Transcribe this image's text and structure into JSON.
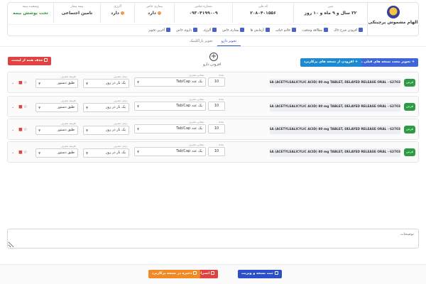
{
  "header": {
    "brand": "الهام مشموش پرچینکی",
    "info": [
      {
        "label": "سن",
        "value": "۳۲ سال و ۹ ماه و ۱۰ روز",
        "width": 104
      },
      {
        "label": "کد ملی",
        "value": "۲۰۸۰۴۰۱۵۵۶",
        "width": 86
      },
      {
        "label": "شماره تماس",
        "value": "۰۹۳۰۴۱۹۹۰۰۹",
        "width": 82
      },
      {
        "label": "بیماری خاص",
        "value": "دارد",
        "width": 56
      },
      {
        "label": "آلرژی",
        "value": "دارد",
        "width": 48
      },
      {
        "label": "بیمه بیمار",
        "value": "تامین اجتماعی",
        "width": 66
      },
      {
        "label": "وضعیت بیمه",
        "value": "تحت پوشش بیمه",
        "width": 64
      }
    ],
    "quick_links": [
      {
        "label": "افزودن شرح حال",
        "icon": "add-history-icon"
      },
      {
        "label": "مطالعه وضعیت",
        "icon": "status-icon"
      },
      {
        "label": "علایم حیاتی",
        "icon": "vital-signs-icon"
      },
      {
        "label": "آزمایش ها",
        "icon": "lab-tests-icon"
      },
      {
        "label": "بیماری خاص",
        "icon": "special-disease-icon"
      },
      {
        "label": "آلرژی",
        "icon": "allergy-icon"
      },
      {
        "label": "داروی خاص",
        "icon": "special-drug-icon"
      },
      {
        "label": "آخرین تجویز",
        "icon": "last-prescription-icon"
      }
    ]
  },
  "tabs": {
    "drug": "تجویز دارو",
    "paraclinic": "تجویز پاراکلینیک"
  },
  "add_drug": {
    "label": "افزودن دارو"
  },
  "actions": {
    "renew": "+ تجویز مجدد نسخه های قبلی بیمار",
    "frequent": "+ افزودن از نسخه های پرکاربرد",
    "delete_all": "حذف همه از لیست"
  },
  "field_labels": {
    "count": "تعداد",
    "unit": "مقادیر مصرف",
    "freq": "زمان مصرف",
    "method": "طریقه مصرف"
  },
  "drugs": [
    {
      "badge": "قرص",
      "name": "ASA (ACETYLSALICYLIC ACID) 80 mg TABLET, DELAYED RELEASE ORAL - 62703",
      "count": "10",
      "unit": "یک عدد Tab/Cap",
      "freq": "یک بار در روز",
      "method": "طبق دستور"
    },
    {
      "badge": "قرص",
      "name": "ASA (ACETYLSALICYLIC ACID) 80 mg TABLET, DELAYED RELEASE ORAL - 62703",
      "count": "10",
      "unit": "یک عدد Tab/Cap",
      "freq": "یک بار در روز",
      "method": "طبق دستور"
    },
    {
      "badge": "قرص",
      "name": "ASA (ACETYLSALICYLIC ACID) 80 mg TABLET, DELAYED RELEASE ORAL - 62703",
      "count": "10",
      "unit": "یک عدد Tab/Cap",
      "freq": "یک بار در روز",
      "method": "طبق دستور"
    },
    {
      "badge": "قرص",
      "name": "ASA (ACETYLSALICYLIC ACID) 80 mg TABLET, DELAYED RELEASE ORAL - 62703",
      "count": "10",
      "unit": "یک عدد Tab/Cap",
      "freq": "یک بار در روز",
      "method": "طبق دستور"
    }
  ],
  "description": {
    "placeholder": "توضیحات"
  },
  "footer": {
    "submit": "ثبت نسخه و ویزیت",
    "cancel": "انصراف",
    "save_frequent": "ذخیره در نسخه پرکاربرد"
  },
  "colors": {
    "primary": "#3f66d8",
    "success": "#2f9a44",
    "danger": "#e04141",
    "warning": "#f08a24"
  }
}
